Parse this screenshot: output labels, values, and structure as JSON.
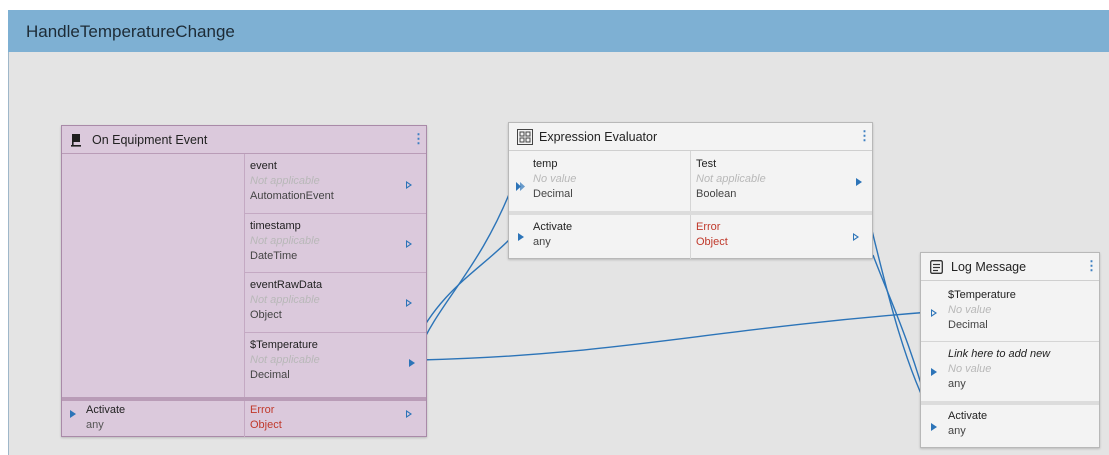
{
  "graph": {
    "title": "HandleTemperatureChange"
  },
  "colors": {
    "title_bar": "#7eb0d3",
    "canvas": "#e4e4e4",
    "wire": "#2c74b8",
    "event_node": "#dbc9dc",
    "error_text": "#c0392b"
  },
  "nodes": {
    "equipment_event": {
      "title": "On Equipment Event",
      "icon": "flag-icon",
      "outputs": [
        {
          "name": "event",
          "value": "Not applicable",
          "type": "AutomationEvent"
        },
        {
          "name": "timestamp",
          "value": "Not applicable",
          "type": "DateTime"
        },
        {
          "name": "eventRawData",
          "value": "Not applicable",
          "type": "Object"
        },
        {
          "name": "$Temperature",
          "value": "Not applicable",
          "type": "Decimal"
        }
      ],
      "activate": {
        "name": "Activate",
        "type": "any"
      },
      "error": {
        "name": "Error",
        "type": "Object"
      }
    },
    "expression_evaluator": {
      "title": "Expression Evaluator",
      "icon": "calculator-icon",
      "input": {
        "name": "temp",
        "value": "No value",
        "type": "Decimal"
      },
      "output": {
        "name": "Test",
        "value": "Not applicable",
        "type": "Boolean"
      },
      "activate": {
        "name": "Activate",
        "type": "any"
      },
      "error": {
        "name": "Error",
        "type": "Object"
      }
    },
    "log_message": {
      "title": "Log Message",
      "icon": "document-icon",
      "inputs": [
        {
          "name": "$Temperature",
          "value": "No value",
          "type": "Decimal"
        },
        {
          "name": "Link here to add new",
          "value": "No value",
          "type": "any"
        }
      ],
      "activate": {
        "name": "Activate",
        "type": "any"
      }
    }
  }
}
